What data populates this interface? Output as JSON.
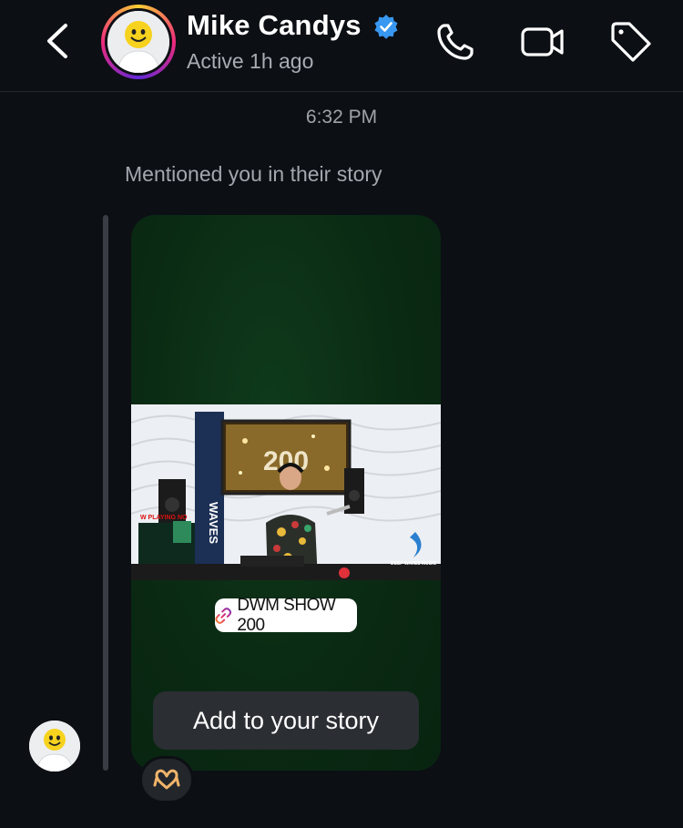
{
  "header": {
    "name": "Mike Candys",
    "status": "Active 1h ago",
    "icons": {
      "back": "chevron-left-icon",
      "verified": "verified-badge-icon",
      "call": "phone-icon",
      "video": "video-camera-icon",
      "tag": "tag-icon"
    }
  },
  "thread": {
    "timestamp": "6:32 PM",
    "mention_text": "Mentioned you in their story",
    "story": {
      "image_overlay_text": "200",
      "link_sticker": "DWM SHOW 200",
      "add_button": "Add to your story"
    },
    "reaction_icon": "heart-hands-emoji"
  },
  "colors": {
    "background": "#0c0f14",
    "verified_blue": "#3897f0",
    "story_green": "#0a2a13"
  }
}
